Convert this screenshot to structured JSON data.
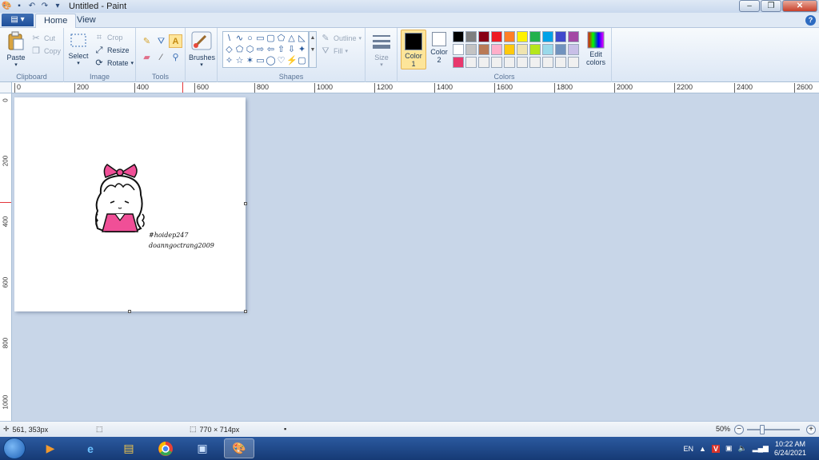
{
  "window": {
    "title": "Untitled - Paint",
    "controls": [
      "minimize",
      "restore",
      "close"
    ]
  },
  "tabs": {
    "file_label": "",
    "items": [
      {
        "label": "Home",
        "active": true
      },
      {
        "label": "View",
        "active": false
      }
    ]
  },
  "ribbon": {
    "clipboard": {
      "group_label": "Clipboard",
      "paste": "Paste",
      "cut": "Cut",
      "copy": "Copy"
    },
    "image": {
      "group_label": "Image",
      "select": "Select",
      "crop": "Crop",
      "resize": "Resize",
      "rotate": "Rotate"
    },
    "tools": {
      "group_label": "Tools",
      "items": [
        "pencil-icon",
        "fill-icon",
        "text-icon",
        "eraser-icon",
        "color-picker-icon",
        "magnifier-icon"
      ]
    },
    "brushes": {
      "label": "Brushes"
    },
    "shapes": {
      "group_label": "Shapes",
      "outline": "Outline",
      "fill": "Fill",
      "glyphs": [
        "\\",
        "∿",
        "○",
        "▭",
        "▢",
        "⬠",
        "△",
        "◺",
        "◇",
        "⬠",
        "⬡",
        "⇨",
        "⇦",
        "⇧",
        "⇩",
        "✦",
        "✧",
        "☆",
        "✶",
        "▭",
        "◯",
        "♡",
        "⚡",
        "▢"
      ]
    },
    "size": {
      "label": "Size"
    },
    "colors": {
      "group_label": "Colors",
      "color1_label": "Color",
      "color1_num": "1",
      "color2_label": "Color",
      "color2_num": "2",
      "edit_label": "Edit",
      "edit_label2": "colors",
      "color1_value": "#000000",
      "color2_value": "#ffffff",
      "palette": [
        "#000000",
        "#7f7f7f",
        "#880015",
        "#ed1c24",
        "#ff7f27",
        "#fff200",
        "#22b14c",
        "#00a2e8",
        "#3f48cc",
        "#a349a4",
        "#ffffff",
        "#c3c3c3",
        "#b97a57",
        "#ffaec9",
        "#ffc90e",
        "#efe4b0",
        "#b5e61d",
        "#99d9ea",
        "#7092be",
        "#c8bfe7",
        "#e8386d",
        "#f0f0f0",
        "#f0f0f0",
        "#f0f0f0",
        "#f0f0f0",
        "#f0f0f0",
        "#f0f0f0",
        "#f0f0f0",
        "#f0f0f0",
        "#f0f0f0"
      ]
    }
  },
  "ruler": {
    "h_labels": [
      "0",
      "200",
      "400",
      "600",
      "800",
      "1000",
      "1200",
      "1400",
      "1600",
      "1800",
      "2000",
      "2200",
      "2400",
      "2600"
    ],
    "v_labels": [
      "0",
      "200",
      "400",
      "600",
      "800",
      "1000"
    ]
  },
  "canvas": {
    "signature_line1": "#hoidep247",
    "signature_line2": "doanngoctrang2009"
  },
  "status": {
    "cursor_pos": "561, 353px",
    "image_size": "770 × 714px",
    "zoom": "50%"
  },
  "taskbar": {
    "apps": [
      "windows-media-player-icon",
      "internet-explorer-icon",
      "file-explorer-icon",
      "chrome-icon",
      "screen-app-icon",
      "paint-icon"
    ],
    "language": "EN",
    "time": "10:22 AM",
    "date": "6/24/2021"
  }
}
